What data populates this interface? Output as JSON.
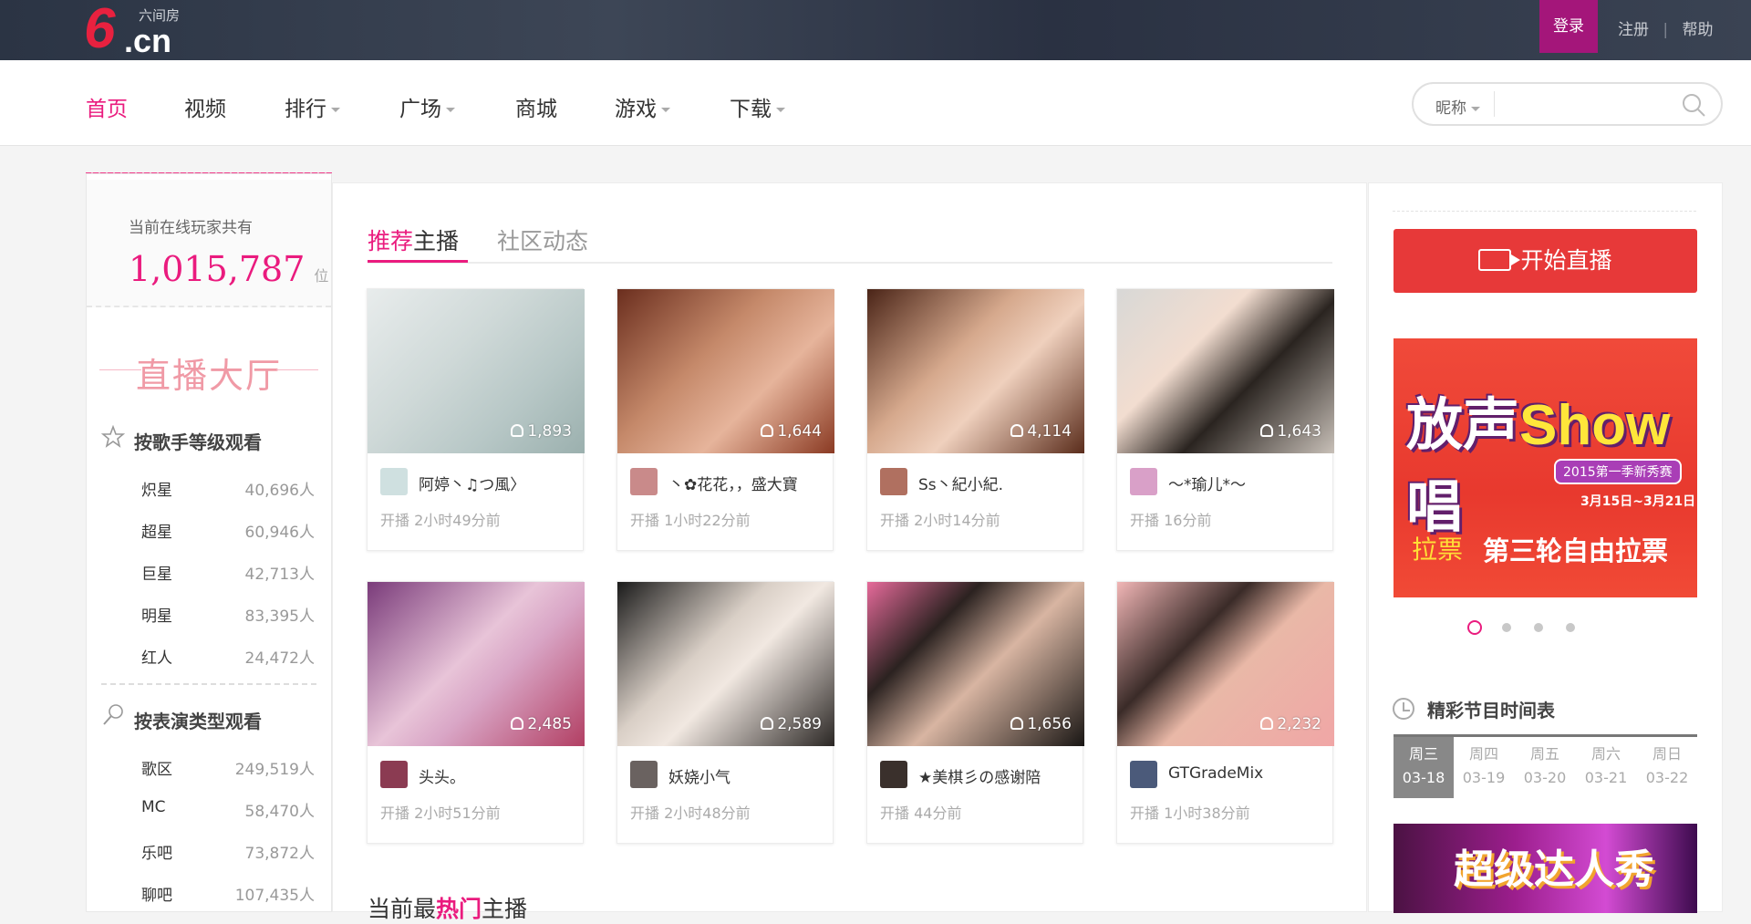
{
  "header": {
    "logo_main": "6",
    "logo_domain": ".cn",
    "logo_sub": "六间房",
    "login": "登录",
    "register": "注册",
    "sep": "|",
    "help": "帮助"
  },
  "nav": {
    "items": [
      {
        "label": "首页",
        "active": true
      },
      {
        "label": "视频"
      },
      {
        "label": "排行",
        "dropdown": true
      },
      {
        "label": "广场",
        "dropdown": true
      },
      {
        "label": "商城"
      },
      {
        "label": "游戏",
        "dropdown": true
      },
      {
        "label": "下载",
        "dropdown": true
      }
    ],
    "search_type": "昵称"
  },
  "sidebar": {
    "online_label": "当前在线玩家共有",
    "online_count": "1,015,787",
    "online_unit": "位",
    "hall_title": "直播大厅",
    "singer_title": "按歌手等级观看",
    "singer_levels": [
      {
        "name": "炽星",
        "count": "40,696人"
      },
      {
        "name": "超星",
        "count": "60,946人"
      },
      {
        "name": "巨星",
        "count": "42,713人"
      },
      {
        "name": "明星",
        "count": "83,395人"
      },
      {
        "name": "红人",
        "count": "24,472人"
      }
    ],
    "perf_title": "按表演类型观看",
    "perf_types": [
      {
        "name": "歌区",
        "count": "249,519人"
      },
      {
        "name": "MC",
        "count": "58,470人"
      },
      {
        "name": "乐吧",
        "count": "73,872人"
      },
      {
        "name": "聊吧",
        "count": "107,435人"
      }
    ]
  },
  "main": {
    "tab1_hl": "推荐",
    "tab1_rest": "主播",
    "tab2": "社区动态",
    "cards": [
      {
        "viewers": "1,893",
        "name": "阿婷丶♫つ風〉",
        "time": "开播 2小时49分前"
      },
      {
        "viewers": "1,644",
        "name": "丶✿花花，，盛大寶",
        "time": "开播 1小时22分前"
      },
      {
        "viewers": "4,114",
        "name": "Ss丶紀小紀.",
        "time": "开播 2小时14分前"
      },
      {
        "viewers": "1,643",
        "name": "～*瑜儿*～",
        "time": "开播 16分前"
      },
      {
        "viewers": "2,485",
        "name": "头头。",
        "time": "开播 2小时51分前"
      },
      {
        "viewers": "2,589",
        "name": "妖娆小气",
        "time": "开播 2小时48分前"
      },
      {
        "viewers": "1,656",
        "name": "★美棋彡の感谢陪",
        "time": "开播 44分前"
      },
      {
        "viewers": "2,232",
        "name": "GTGradeMix",
        "time": "开播 1小时38分前"
      }
    ],
    "hot_prefix": "当前最",
    "hot_hl": "热门",
    "hot_suffix": "主播"
  },
  "right": {
    "live_button": "开始直播",
    "banner_title_a": "放声",
    "banner_title_b": "Show",
    "banner_title_c": "唱",
    "banner_badge": "2015第一季新秀赛",
    "banner_dates": "3月15日~3月21日",
    "banner_vote": "拉票",
    "banner_round": "第三轮自由拉票",
    "schedule_title": "精彩节目时间表",
    "days": [
      {
        "w": "周三",
        "d": "03-18",
        "active": true
      },
      {
        "w": "周四",
        "d": "03-19"
      },
      {
        "w": "周五",
        "d": "03-20"
      },
      {
        "w": "周六",
        "d": "03-21"
      },
      {
        "w": "周日",
        "d": "03-22"
      }
    ],
    "promo_text": "超级达人秀"
  },
  "colors": {
    "accent": "#ea1b7e",
    "live_red": "#e73939",
    "topbar": "#2f3848"
  }
}
